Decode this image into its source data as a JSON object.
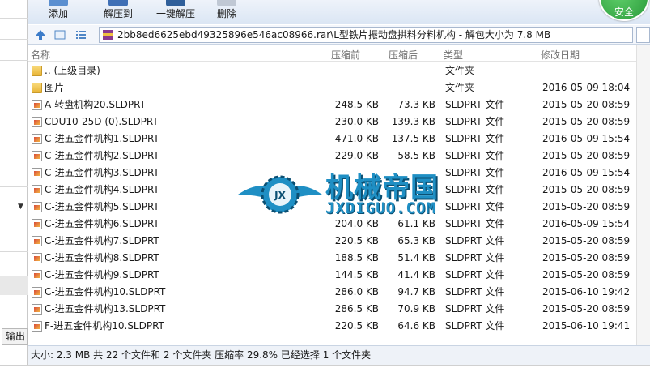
{
  "toolbar": {
    "buttons": [
      {
        "label": "添加",
        "icon": "add-icon"
      },
      {
        "label": "解压到",
        "icon": "extract-to-icon"
      },
      {
        "label": "一键解压",
        "icon": "one-click-extract-icon"
      },
      {
        "label": "删除",
        "icon": "delete-icon"
      }
    ],
    "badge_label": "安全"
  },
  "address": {
    "path": "2bb8ed6625ebd49325896e546ac08966.rar\\L型铁片振动盘拱料分料机构 - 解包大小为 7.8 MB"
  },
  "columns": {
    "name": "名称",
    "compressed": "压缩前",
    "uncompressed": "压缩后",
    "type": "类型",
    "modified": "修改日期"
  },
  "files": [
    {
      "icon": "folder",
      "name": ".. (上级目录)",
      "compressed": "",
      "uncompressed": "",
      "type": "文件夹",
      "modified": ""
    },
    {
      "icon": "folder",
      "name": "图片",
      "compressed": "",
      "uncompressed": "",
      "type": "文件夹",
      "modified": "2016-05-09 18:04"
    },
    {
      "icon": "file",
      "name": "A-转盘机构20.SLDPRT",
      "compressed": "248.5 KB",
      "uncompressed": "73.3 KB",
      "type": "SLDPRT 文件",
      "modified": "2015-05-20 08:59"
    },
    {
      "icon": "file",
      "name": "CDU10-25D (0).SLDPRT",
      "compressed": "230.0 KB",
      "uncompressed": "139.3 KB",
      "type": "SLDPRT 文件",
      "modified": "2015-05-20 08:59"
    },
    {
      "icon": "file",
      "name": "C-进五金件机构1.SLDPRT",
      "compressed": "471.0 KB",
      "uncompressed": "137.5 KB",
      "type": "SLDPRT 文件",
      "modified": "2016-05-09 15:54"
    },
    {
      "icon": "file",
      "name": "C-进五金件机构2.SLDPRT",
      "compressed": "229.0 KB",
      "uncompressed": "58.5 KB",
      "type": "SLDPRT 文件",
      "modified": "2015-05-20 08:59"
    },
    {
      "icon": "file",
      "name": "C-进五金件机构3.SLDPRT",
      "compressed": "",
      "uncompressed": "",
      "type": "SLDPRT 文件",
      "modified": "2016-05-09 15:54"
    },
    {
      "icon": "file",
      "name": "C-进五金件机构4.SLDPRT",
      "compressed": "",
      "uncompressed": "",
      "type": "SLDPRT 文件",
      "modified": "2015-05-20 08:59"
    },
    {
      "icon": "file",
      "name": "C-进五金件机构5.SLDPRT",
      "compressed": "",
      "uncompressed": "",
      "type": "SLDPRT 文件",
      "modified": "2015-05-20 08:59"
    },
    {
      "icon": "file",
      "name": "C-进五金件机构6.SLDPRT",
      "compressed": "204.0 KB",
      "uncompressed": "61.1 KB",
      "type": "SLDPRT 文件",
      "modified": "2016-05-09 15:54"
    },
    {
      "icon": "file",
      "name": "C-进五金件机构7.SLDPRT",
      "compressed": "220.5 KB",
      "uncompressed": "65.3 KB",
      "type": "SLDPRT 文件",
      "modified": "2015-05-20 08:59"
    },
    {
      "icon": "file",
      "name": "C-进五金件机构8.SLDPRT",
      "compressed": "188.5 KB",
      "uncompressed": "51.4 KB",
      "type": "SLDPRT 文件",
      "modified": "2015-05-20 08:59"
    },
    {
      "icon": "file",
      "name": "C-进五金件机构9.SLDPRT",
      "compressed": "144.5 KB",
      "uncompressed": "41.4 KB",
      "type": "SLDPRT 文件",
      "modified": "2015-05-20 08:59"
    },
    {
      "icon": "file",
      "name": "C-进五金件机构10.SLDPRT",
      "compressed": "286.0 KB",
      "uncompressed": "94.7 KB",
      "type": "SLDPRT 文件",
      "modified": "2015-06-10 19:42"
    },
    {
      "icon": "file",
      "name": "C-进五金件机构13.SLDPRT",
      "compressed": "286.5 KB",
      "uncompressed": "70.9 KB",
      "type": "SLDPRT 文件",
      "modified": "2015-05-20 08:59"
    },
    {
      "icon": "file",
      "name": "F-进五金件机构10.SLDPRT",
      "compressed": "220.5 KB",
      "uncompressed": "64.6 KB",
      "type": "SLDPRT 文件",
      "modified": "2015-06-10 19:41"
    }
  ],
  "status": "大小: 2.3 MB 共 22 个文件和 2 个文件夹 压缩率 29.8% 已经选择 1 个文件夹",
  "watermark": {
    "title": "机械帝国",
    "subtitle": "JXDIGUO.COM",
    "emblem": "JX"
  },
  "background": {
    "output_label": "输出"
  }
}
